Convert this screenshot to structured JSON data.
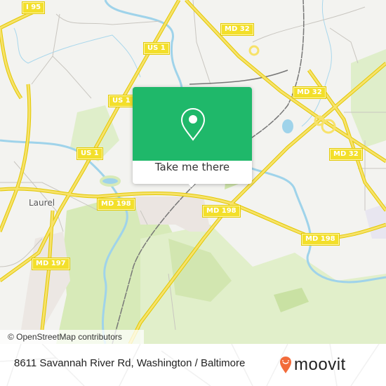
{
  "map": {
    "road_shields": [
      {
        "id": "i95",
        "label": "I 95"
      },
      {
        "id": "us1-top",
        "label": "US 1"
      },
      {
        "id": "us1-mid",
        "label": "US 1"
      },
      {
        "id": "us1-low",
        "label": "US 1"
      },
      {
        "id": "md32-top",
        "label": "MD 32"
      },
      {
        "id": "md32-right",
        "label": "MD 32"
      },
      {
        "id": "md32-lower",
        "label": "MD 32"
      },
      {
        "id": "md198-left",
        "label": "MD 198"
      },
      {
        "id": "md198-center",
        "label": "MD 198"
      },
      {
        "id": "md198-right",
        "label": "MD 198"
      },
      {
        "id": "md197",
        "label": "MD 197"
      }
    ],
    "places": [
      {
        "id": "laurel",
        "label": "Laurel"
      }
    ],
    "attribution": "© OpenStreetMap contributors",
    "colors": {
      "background": "#f3f3f0",
      "park": "#d7eab8",
      "water": "#9fd3ea",
      "highway": "#f7e26a",
      "road": "#c9c6c0",
      "rail": "#777777"
    }
  },
  "popup": {
    "pin_icon": "map-pin-icon",
    "cta_label": "Take me there",
    "accent": "#1fb86a"
  },
  "footer": {
    "address": "8611 Savannah River Rd, Washington / Baltimore",
    "brand": "moovit",
    "brand_color": "#f26b3a"
  }
}
